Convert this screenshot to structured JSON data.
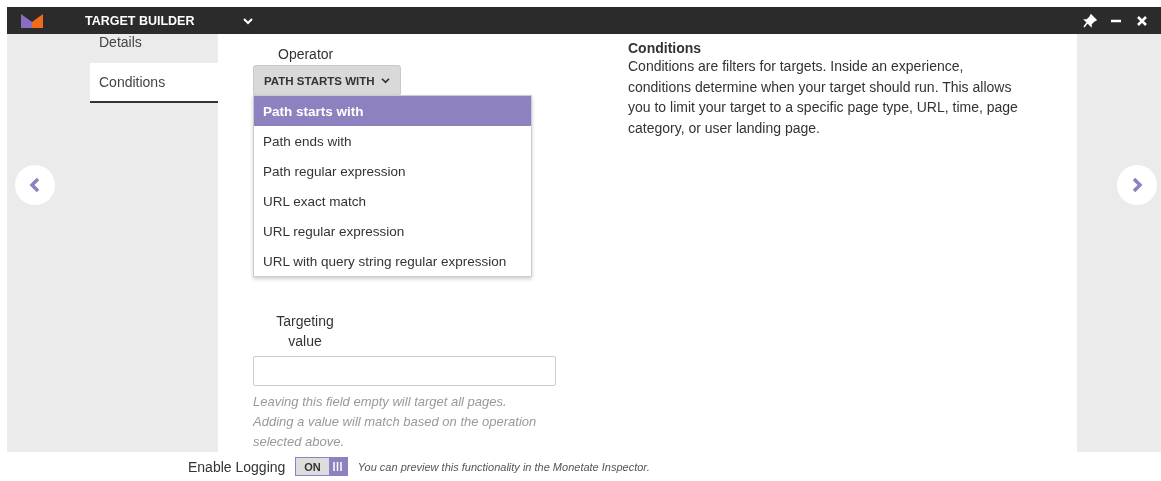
{
  "window": {
    "title": "TARGET BUILDER"
  },
  "sidebar": {
    "items": [
      {
        "label": "Details",
        "selected": false
      },
      {
        "label": "Conditions",
        "selected": true
      }
    ]
  },
  "operator": {
    "label": "Operator",
    "value": "PATH STARTS WITH",
    "expanded": true,
    "options": [
      {
        "label": "Path starts with",
        "selected": true
      },
      {
        "label": "Path ends with",
        "selected": false
      },
      {
        "label": "Path regular expression",
        "selected": false
      },
      {
        "label": "URL exact match",
        "selected": false
      },
      {
        "label": "URL regular expression",
        "selected": false
      },
      {
        "label": "URL with query string regular expression",
        "selected": false
      }
    ]
  },
  "targeting": {
    "label": "Targeting value",
    "help": "Leaving this field empty will target all pages. Adding a value will match based on the operation selected above."
  },
  "info": {
    "title": "Conditions",
    "text": "Conditions are filters for targets. Inside an experience, conditions determine when your target should run. This allows you to limit your target to a specific page type, URL, time, page category, or user landing page."
  },
  "logging": {
    "label": "Enable Logging",
    "toggle": "ON",
    "on": true,
    "note": "You can preview this functionality in the Monetate Inspector."
  }
}
